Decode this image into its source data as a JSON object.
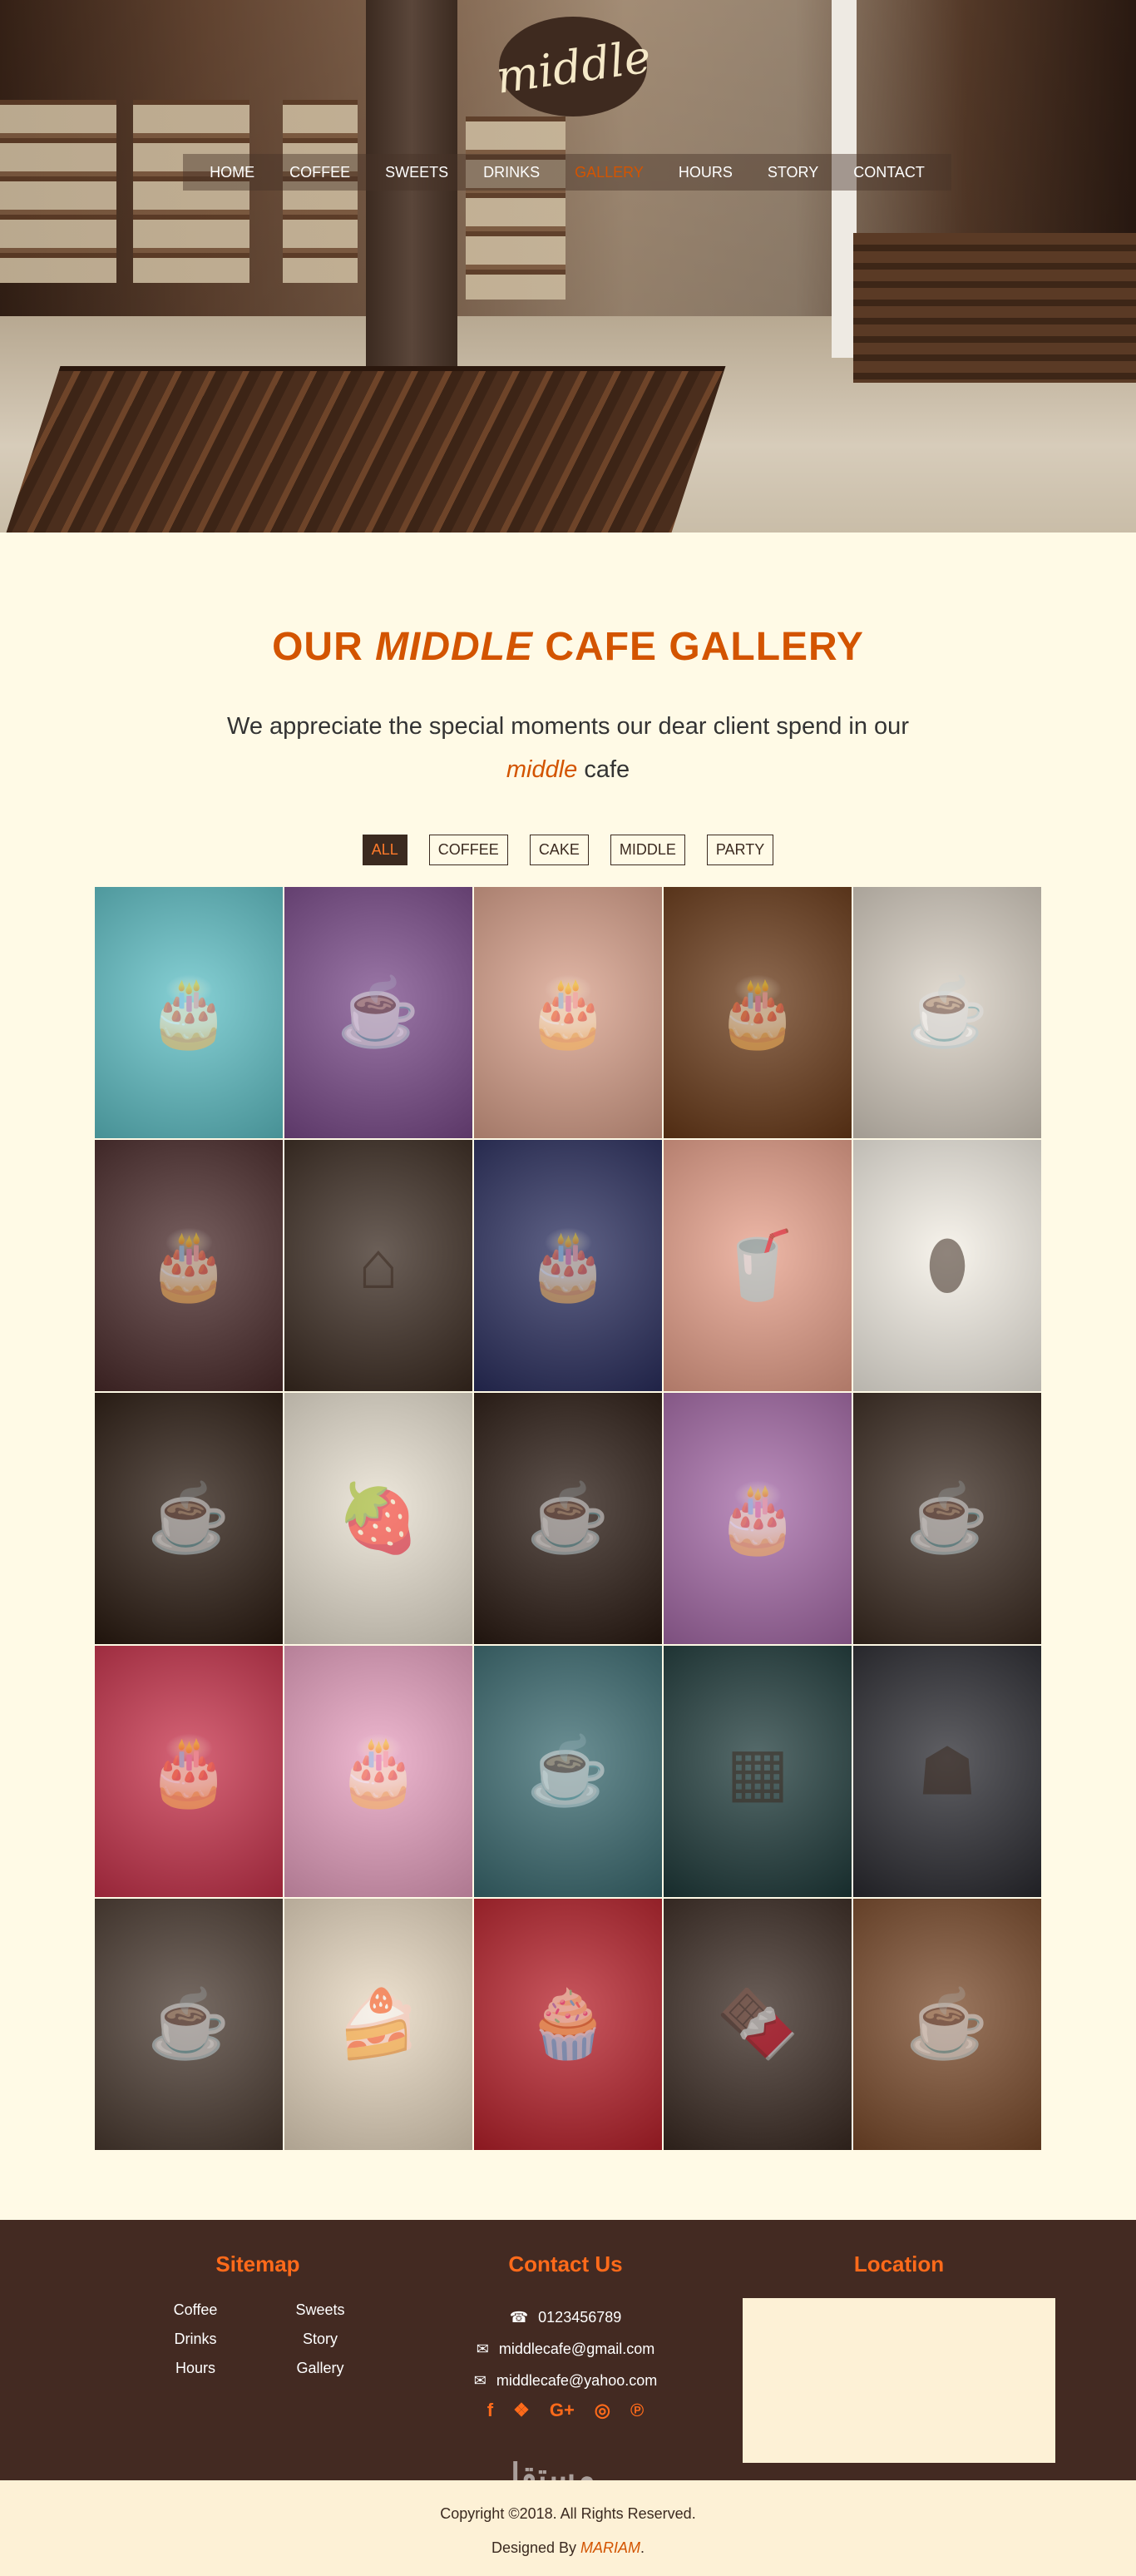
{
  "brand": {
    "logo_text": "middle"
  },
  "nav": {
    "items": [
      "HOME",
      "COFFEE",
      "SWEETS",
      "DRINKS",
      "GALLERY",
      "HOURS",
      "STORY",
      "CONTACT"
    ],
    "active": "GALLERY",
    "active_color": "#d35400"
  },
  "gallery": {
    "title_pre": "OUR ",
    "title_em": "MIDDLE",
    "title_post": " CAFE GALLERY",
    "subtitle_pre": "We appreciate the special moments our dear client spend in our",
    "subtitle_em": "middle",
    "subtitle_post": " cafe",
    "filters": [
      "ALL",
      "COFFEE",
      "CAKE",
      "MIDDLE",
      "PARTY"
    ],
    "active_filter": "ALL",
    "tiles": [
      {
        "icon": "cake-icon",
        "color": "#5fc1c7"
      },
      {
        "icon": "coffee-cup-icon",
        "color": "#7a4a8a"
      },
      {
        "icon": "cake-icon",
        "color": "#d9a08a"
      },
      {
        "icon": "cake-icon",
        "color": "#6a3a18"
      },
      {
        "icon": "coffee-cup-icon",
        "color": "#d8cfc2"
      },
      {
        "icon": "cake-icon",
        "color": "#4a2a2a"
      },
      {
        "icon": "cafe-interior-icon",
        "color": "#3a2a20"
      },
      {
        "icon": "cake-icon",
        "color": "#2a2e5e"
      },
      {
        "icon": "drink-icon",
        "color": "#e8a08a"
      },
      {
        "icon": "coffee-beans-icon",
        "color": "#f5f0e6"
      },
      {
        "icon": "coffee-cup-icon",
        "color": "#2a1a10"
      },
      {
        "icon": "fruit-icon",
        "color": "#e8e0d0"
      },
      {
        "icon": "coffee-cup-icon",
        "color": "#2a1a12"
      },
      {
        "icon": "cake-icon",
        "color": "#a66aa8"
      },
      {
        "icon": "coffee-cup-icon",
        "color": "#3a2a20"
      },
      {
        "icon": "cake-icon",
        "color": "#c8314a"
      },
      {
        "icon": "cake-icon",
        "color": "#e8a0c0"
      },
      {
        "icon": "barista-icon",
        "color": "#3a6a70"
      },
      {
        "icon": "chalkboard-icon",
        "color": "#1e3a3a"
      },
      {
        "icon": "espresso-machine-icon",
        "color": "#2a2a30"
      },
      {
        "icon": "barista-icon",
        "color": "#4a3a30"
      },
      {
        "icon": "cheesecake-icon",
        "color": "#e8d8c0"
      },
      {
        "icon": "cupcake-icon",
        "color": "#b8202a"
      },
      {
        "icon": "chocolate-dessert-icon",
        "color": "#3a2a22"
      },
      {
        "icon": "coffee-cup-icon",
        "color": "#7a4a2a"
      }
    ]
  },
  "footer": {
    "sitemap_title": "Sitemap",
    "sitemap_links": [
      "Coffee",
      "Sweets",
      "Drinks",
      "Story",
      "Hours",
      "Gallery"
    ],
    "contact_title": "Contact Us",
    "phone": "0123456789",
    "email1": "middlecafe@gmail.com",
    "email2": "middlecafe@yahoo.com",
    "social_icons": [
      "facebook-icon",
      "twitter-icon",
      "google-plus-icon",
      "instagram-icon",
      "pinterest-icon"
    ],
    "social_glyphs": [
      "f",
      "❖",
      "G+",
      "◎",
      "℗"
    ],
    "location_title": "Location"
  },
  "copyright": {
    "text": "Copyright ©2018. All Rights Reserved.",
    "designed_by": "Designed By ",
    "designer": "MARIAM",
    "period": "."
  },
  "watermark": "مستقل"
}
